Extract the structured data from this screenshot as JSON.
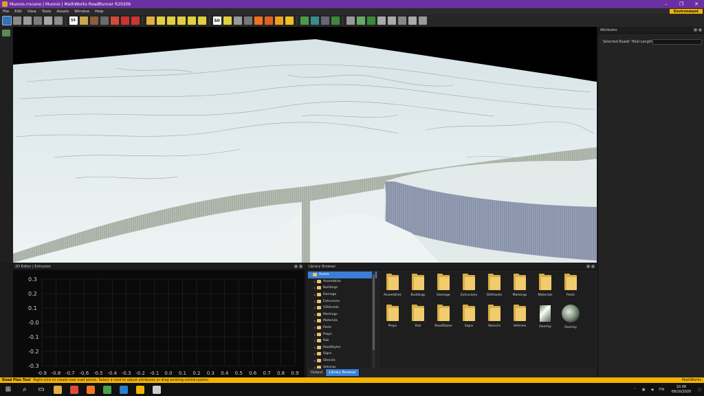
{
  "window": {
    "title": "Muonio.rrscene | Muonio | MathWorks RoadRunner R2020b",
    "minimize": "–",
    "maximize": "❐",
    "close": "✕"
  },
  "menu": {
    "items": [
      "File",
      "Edit",
      "View",
      "Tools",
      "Assets",
      "Window",
      "Help"
    ],
    "environment_badge": "Environment"
  },
  "toolbar": {
    "icons": [
      "road-plan-icon",
      "circle-tool-icon",
      "lane-icon",
      "lane-width-icon",
      "lane-add-icon",
      "lane-form-icon",
      "speed-limit-icon",
      "marking-icon",
      "prop-icon",
      "junction-icon",
      "crosswalk-icon",
      "signal-icon",
      "stop-icon",
      "traffic-light-icon",
      "lane-carve-icon",
      "marking-point-icon",
      "marking-curve-icon",
      "marking-span-icon",
      "marking-stretch-icon",
      "sign-50-icon",
      "curve-road-icon",
      "surface-icon",
      "rail-icon",
      "cone-icon",
      "barrier-icon",
      "warning-icon",
      "signage-icon",
      "terrain-icon",
      "elevation-map-icon",
      "satellite-icon",
      "vegetation-icon",
      "layer-a-icon",
      "layer-b-icon",
      "layer-c-icon",
      "cut-icon",
      "overlay-icon",
      "camera-icon",
      "route-icon",
      "building-icon"
    ],
    "sign_label": "50",
    "speed_label": "55"
  },
  "attributes": {
    "header": "Attributes",
    "selected_roads_label": "Selected Roads' Total Length",
    "selected_roads_value": ""
  },
  "editor2d": {
    "header": "2D Editor | Extrusion",
    "y_ticks": [
      "0.3",
      "0.2",
      "0.1",
      "-0.0",
      "-0.1",
      "-0.2",
      "-0.3"
    ],
    "x_ticks": [
      "-0.9",
      "-0.8",
      "-0.7",
      "-0.6",
      "-0.5",
      "-0.4",
      "-0.3",
      "-0.2",
      "-0.1",
      "0.0",
      "0.1",
      "0.2",
      "0.3",
      "0.4",
      "0.5",
      "0.6",
      "0.7",
      "0.8",
      "0.9"
    ]
  },
  "library": {
    "header": "Library Browser",
    "tree": [
      {
        "label": "Assets",
        "selected": true,
        "level": 0
      },
      {
        "label": "Assemblies",
        "level": 1
      },
      {
        "label": "Buildings",
        "level": 1
      },
      {
        "label": "Damage",
        "level": 1
      },
      {
        "label": "Extrusions",
        "level": 1
      },
      {
        "label": "GISAssets",
        "level": 1
      },
      {
        "label": "Markings",
        "level": 1
      },
      {
        "label": "Materials",
        "level": 1
      },
      {
        "label": "Posts",
        "level": 1
      },
      {
        "label": "Props",
        "level": 1
      },
      {
        "label": "Rail",
        "level": 1
      },
      {
        "label": "RoadStyles",
        "level": 1
      },
      {
        "label": "Signs",
        "level": 1
      },
      {
        "label": "Stencils",
        "level": 1
      },
      {
        "label": "Vehicles",
        "level": 1
      }
    ],
    "grid": [
      {
        "label": "Assemblies",
        "kind": "folder"
      },
      {
        "label": "Buildings",
        "kind": "folder"
      },
      {
        "label": "Damage",
        "kind": "folder"
      },
      {
        "label": "Extrusions",
        "kind": "folder"
      },
      {
        "label": "GISAssets",
        "kind": "folder"
      },
      {
        "label": "Markings",
        "kind": "folder"
      },
      {
        "label": "Materials",
        "kind": "folder"
      },
      {
        "label": "Posts",
        "kind": "folder"
      },
      {
        "label": "Props",
        "kind": "folder"
      },
      {
        "label": "Rail",
        "kind": "folder"
      },
      {
        "label": "RoadStyles",
        "kind": "folder"
      },
      {
        "label": "Signs",
        "kind": "folder"
      },
      {
        "label": "Stencils",
        "kind": "folder"
      },
      {
        "label": "Vehicles",
        "kind": "folder"
      },
      {
        "label": "Overlay",
        "kind": "overlay-a"
      },
      {
        "label": "Overlay",
        "kind": "overlay-b"
      }
    ],
    "tabs": [
      "Output",
      "Library Browser"
    ],
    "active_tab": "Library Browser"
  },
  "status": {
    "tool_name": "Road Plan Tool",
    "message": "Right-click to create new road points. Select a road to adjust attributes or drag existing control points.",
    "brand": "MathWorks"
  },
  "taskbar": {
    "icons": [
      "windows-start-icon",
      "search-icon",
      "task-view-icon",
      "file-explorer-icon",
      "chrome-icon",
      "firefox-icon",
      "qgis-icon",
      "edge-icon",
      "roadrunner-icon",
      "app-icon"
    ],
    "language": "FIN",
    "time": "10.08",
    "date": "09/10/2020"
  },
  "colors": {
    "title_bar": "#6a2fa0",
    "accent_yellow": "#f2b400",
    "selection_blue": "#3a7fd5",
    "folder_yellow": "#f1cc6c"
  }
}
